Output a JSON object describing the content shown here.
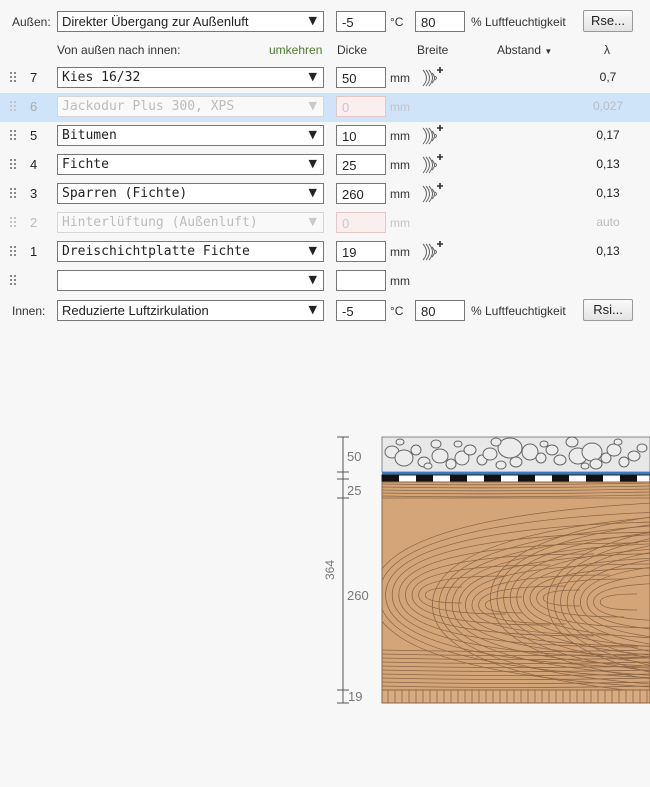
{
  "outside": {
    "label": "Außen:",
    "condition": "Direkter Übergang zur Außenluft",
    "temperature": "-5",
    "temp_unit": "°C",
    "humidity": "80",
    "humidity_unit": "% Luftfeuchtigkeit",
    "button": "Rse..."
  },
  "inside": {
    "label": "Innen:",
    "condition": "Reduzierte Luftzirkulation",
    "temperature": "-5",
    "temp_unit": "°C",
    "humidity": "80",
    "humidity_unit": "% Luftfeuchtigkeit",
    "button": "Rsi..."
  },
  "header": {
    "direction": "Von außen nach innen:",
    "reverse": "umkehren",
    "thickness": "Dicke",
    "width": "Breite",
    "spacing": "Abstand",
    "lambda": "λ"
  },
  "layers": [
    {
      "num": "7",
      "material": "Kies 16/32",
      "thickness": "50",
      "unit": "mm",
      "lambda": "0,7",
      "enabled": true,
      "selected": false
    },
    {
      "num": "6",
      "material": "Jackodur Plus 300, XPS",
      "thickness": "0",
      "unit": "mm",
      "lambda": "0,027",
      "enabled": false,
      "selected": true
    },
    {
      "num": "5",
      "material": "Bitumen",
      "thickness": "10",
      "unit": "mm",
      "lambda": "0,17",
      "enabled": true,
      "selected": false
    },
    {
      "num": "4",
      "material": "Fichte",
      "thickness": "25",
      "unit": "mm",
      "lambda": "0,13",
      "enabled": true,
      "selected": false
    },
    {
      "num": "3",
      "material": "Sparren (Fichte)",
      "thickness": "260",
      "unit": "mm",
      "lambda": "0,13",
      "enabled": true,
      "selected": false
    },
    {
      "num": "2",
      "material": "Hinterlüftung (Außenluft)",
      "thickness": "0",
      "unit": "mm",
      "lambda": "auto",
      "enabled": false,
      "selected": false
    },
    {
      "num": "1",
      "material": "Dreischichtplatte Fichte",
      "thickness": "19",
      "unit": "mm",
      "lambda": "0,13",
      "enabled": true,
      "selected": false
    },
    {
      "num": "",
      "material": "",
      "thickness": "",
      "unit": "mm",
      "lambda": "",
      "enabled": true,
      "selected": false
    }
  ],
  "diagram": {
    "total": "364",
    "dims": [
      "50",
      "25",
      "260",
      "19"
    ]
  },
  "icons": {
    "grip": "drag-handle-icon",
    "layer": "wood-grain-add-icon",
    "dropdown": "triangle-down-icon"
  }
}
